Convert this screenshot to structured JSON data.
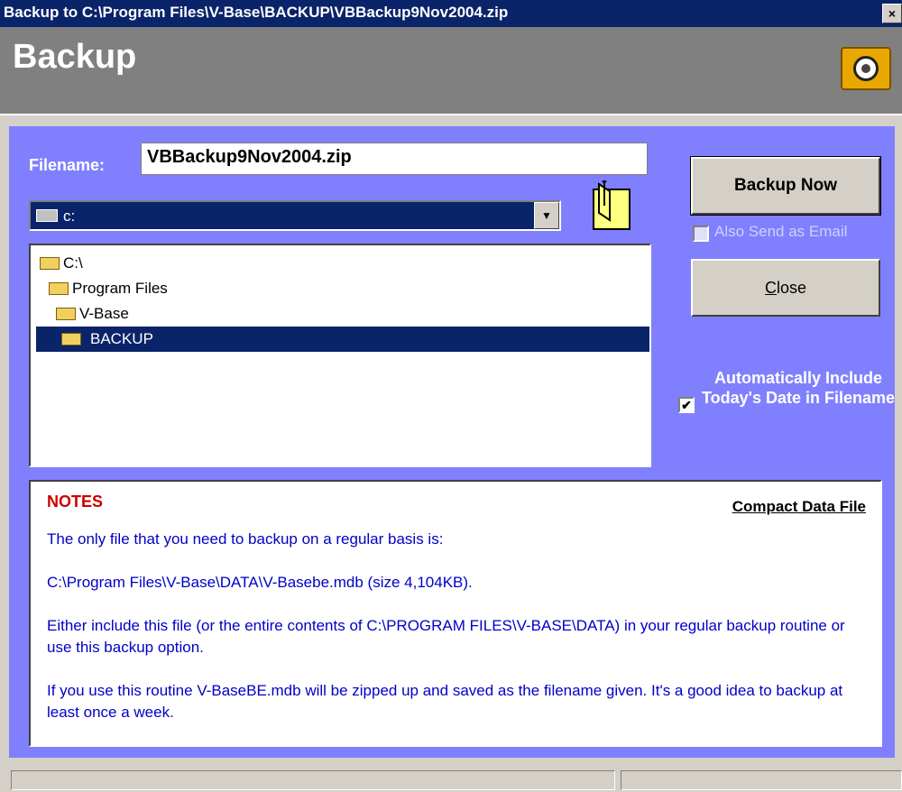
{
  "window": {
    "title": "Backup to C:\\Program Files\\V-Base\\BACKUP\\VBBackup9Nov2004.zip",
    "close_glyph": "×"
  },
  "header": {
    "title": "Backup",
    "icon": "safe-icon"
  },
  "form": {
    "filename_label": "Filename:",
    "filename_value": "VBBackup9Nov2004.zip",
    "drive_value": "c:"
  },
  "tree": {
    "items": [
      {
        "label": "C:\\"
      },
      {
        "label": "Program Files"
      },
      {
        "label": "V-Base"
      },
      {
        "label": "BACKUP"
      }
    ]
  },
  "buttons": {
    "backup_now": "Backup Now",
    "close": "Close"
  },
  "options": {
    "email_label": "Also Send as Email",
    "email_checked": false,
    "date_label": "Automatically Include Today's Date in Filename",
    "date_checked": true
  },
  "notes": {
    "title": "NOTES",
    "compact_link": "Compact Data File",
    "lines": [
      "The only file that you need to backup on a regular basis is:",
      "C:\\Program Files\\V-Base\\DATA\\V-Basebe.mdb (size 4,104KB).",
      "Either include this file (or the entire contents of C:\\PROGRAM FILES\\V-BASE\\DATA) in your regular backup routine or use this backup option.",
      "If you use this routine V-BaseBE.mdb will be zipped up and saved as the filename given.  It's a good idea to backup at least once a week."
    ]
  },
  "colors": {
    "accent": "#8080ff",
    "title_bar": "#0a246a",
    "notes_title": "#cc0000",
    "notes_text": "#0000c8"
  }
}
